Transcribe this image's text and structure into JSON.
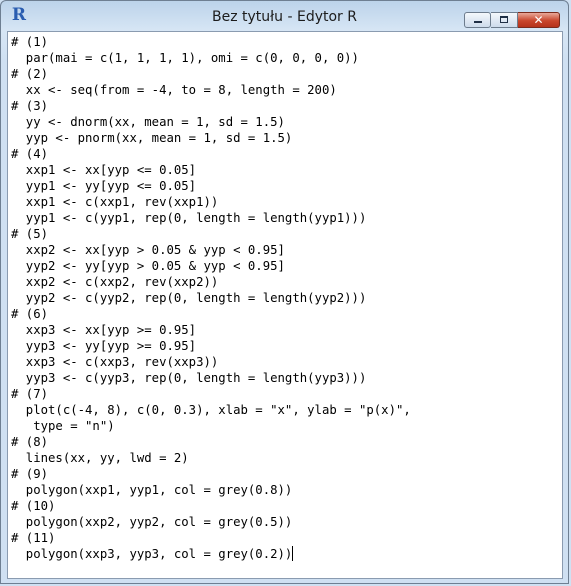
{
  "window": {
    "title": "Bez tytułu - Edytor R",
    "app_icon": "R",
    "controls": {
      "minimize_icon": "minimize-icon",
      "maximize_icon": "maximize-icon",
      "close_label": "✕"
    }
  },
  "editor": {
    "lines": [
      "# (1)",
      "  par(mai = c(1, 1, 1, 1), omi = c(0, 0, 0, 0))",
      "# (2)",
      "  xx <- seq(from = -4, to = 8, length = 200)",
      "# (3)",
      "  yy <- dnorm(xx, mean = 1, sd = 1.5)",
      "  yyp <- pnorm(xx, mean = 1, sd = 1.5)",
      "# (4)",
      "  xxp1 <- xx[yyp <= 0.05]",
      "  yyp1 <- yy[yyp <= 0.05]",
      "  xxp1 <- c(xxp1, rev(xxp1))",
      "  yyp1 <- c(yyp1, rep(0, length = length(yyp1)))",
      "# (5)",
      "  xxp2 <- xx[yyp > 0.05 & yyp < 0.95]",
      "  yyp2 <- yy[yyp > 0.05 & yyp < 0.95]",
      "  xxp2 <- c(xxp2, rev(xxp2))",
      "  yyp2 <- c(yyp2, rep(0, length = length(yyp2)))",
      "# (6)",
      "  xxp3 <- xx[yyp >= 0.95]",
      "  yyp3 <- yy[yyp >= 0.95]",
      "  xxp3 <- c(xxp3, rev(xxp3))",
      "  yyp3 <- c(yyp3, rep(0, length = length(yyp3)))",
      "# (7)",
      "  plot(c(-4, 8), c(0, 0.3), xlab = \"x\", ylab = \"p(x)\",",
      "   type = \"n\")",
      "# (8)",
      "  lines(xx, yy, lwd = 2)",
      "# (9)",
      "  polygon(xxp1, yyp1, col = grey(0.8))",
      "# (10)",
      "  polygon(xxp2, yyp2, col = grey(0.5))",
      "# (11)",
      "  polygon(xxp3, yyp3, col = grey(0.2))"
    ]
  }
}
